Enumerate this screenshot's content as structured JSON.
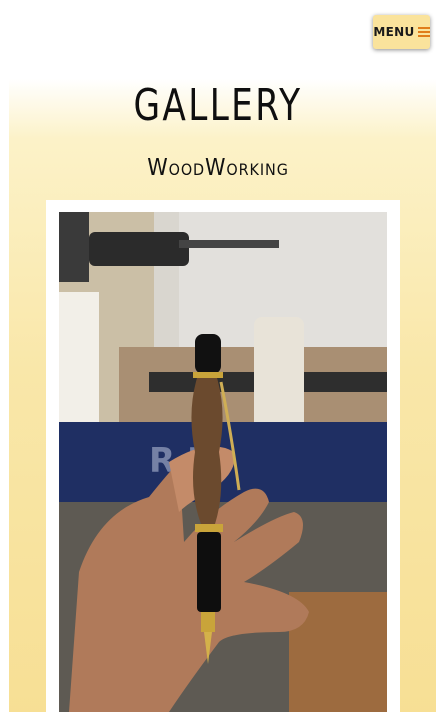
{
  "header": {
    "menu_label": "MENU",
    "menu_icon": "hamburger-icon"
  },
  "page": {
    "title": "GALLERY",
    "subtitle": "WoodWorking"
  },
  "gallery": {
    "items": [
      {
        "description": "Hand holding a handmade wooden pen in front of a lathe"
      }
    ]
  },
  "colors": {
    "background_top": "#ffffff",
    "background_gradient": "#f7df94",
    "menu_button": "#fae39c",
    "menu_icon": "#e07d1a"
  }
}
